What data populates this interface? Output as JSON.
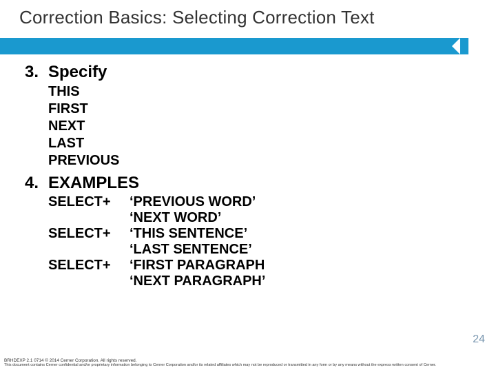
{
  "title": "Correction Basics: Selecting Correction Text",
  "items": [
    {
      "num": "3.",
      "heading": "Specify",
      "bullets": [
        "THIS",
        "FIRST",
        "NEXT",
        "LAST",
        "PREVIOUS"
      ]
    },
    {
      "num": "4.",
      "heading": "EXAMPLES",
      "examples": [
        {
          "left": "SELECT+",
          "right": "‘PREVIOUS WORD’"
        },
        {
          "left": "",
          "right": "‘NEXT WORD’"
        },
        {
          "left": "SELECT+",
          "right": "‘THIS SENTENCE’"
        },
        {
          "left": "",
          "right": "‘LAST SENTENCE’"
        },
        {
          "left": "SELECT+",
          "right": "‘FIRST PARAGRAPH"
        },
        {
          "left": "",
          "right": "‘NEXT PARAGRAPH’"
        }
      ]
    }
  ],
  "footer": {
    "line1": "BRHDEXP 2.1 0714    © 2014 Cerner Corporation. All rights reserved.",
    "line2": "This document contains Cerner confidential and/or proprietary information belonging to Cerner Corporation and/or its related affiliates which may not be reproduced or transmitted in any form or by any means without the express written consent of Cerner."
  },
  "page_number": "24"
}
